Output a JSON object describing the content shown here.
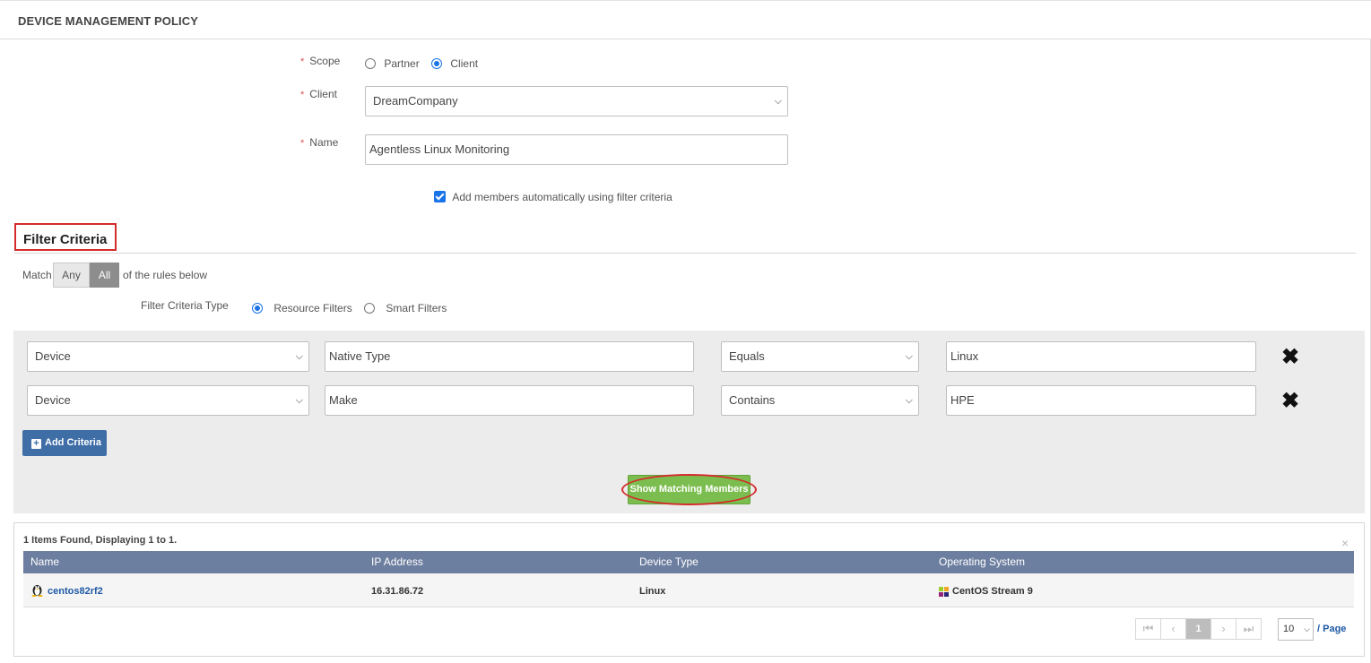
{
  "header": {
    "title": "DEVICE MANAGEMENT POLICY"
  },
  "form": {
    "scope": {
      "label": "Scope",
      "required": "*",
      "options": [
        "Partner",
        "Client"
      ],
      "selected": "Client"
    },
    "client": {
      "label": "Client",
      "required": "*",
      "value": "DreamCompany"
    },
    "name": {
      "label": "Name",
      "required": "*",
      "value": "Agentless Linux Monitoring"
    },
    "auto_members": {
      "label": "Add members automatically using filter criteria",
      "checked": true
    }
  },
  "filter": {
    "heading": "Filter Criteria",
    "match_label": "Match",
    "match_options": [
      "Any",
      "All"
    ],
    "match_selected": "All",
    "match_suffix": "of the rules below",
    "type_label": "Filter Criteria Type",
    "type_options": [
      "Resource Filters",
      "Smart Filters"
    ],
    "type_selected": "Resource Filters",
    "rows": [
      {
        "entity": "Device",
        "attribute": "Native Type",
        "operator": "Equals",
        "value": "Linux"
      },
      {
        "entity": "Device",
        "attribute": "Make",
        "operator": "Contains",
        "value": "HPE"
      }
    ],
    "add_label": "Add Criteria",
    "show_label": "Show Matching Members"
  },
  "results": {
    "summary": "1 Items Found, Displaying 1 to 1.",
    "close": "×",
    "columns": [
      "Name",
      "IP Address",
      "Device Type",
      "Operating System"
    ],
    "rows": [
      {
        "name": "centos82rf2",
        "ip": "16.31.86.72",
        "type": "Linux",
        "os": "CentOS Stream 9"
      }
    ]
  },
  "pagination": {
    "current": "1",
    "page_size": "10",
    "per_page_label": "/ Page"
  },
  "icons": {
    "remove": "close-icon",
    "add": "plus-square-icon",
    "device": "linux-tux-icon",
    "os": "centos-icon"
  },
  "colors": {
    "accent": "#1a73e8",
    "table_header": "#6d7fa0",
    "add_button": "#3f6ea7",
    "show_button": "#7bbd4e",
    "highlight": "#d42b2b"
  }
}
